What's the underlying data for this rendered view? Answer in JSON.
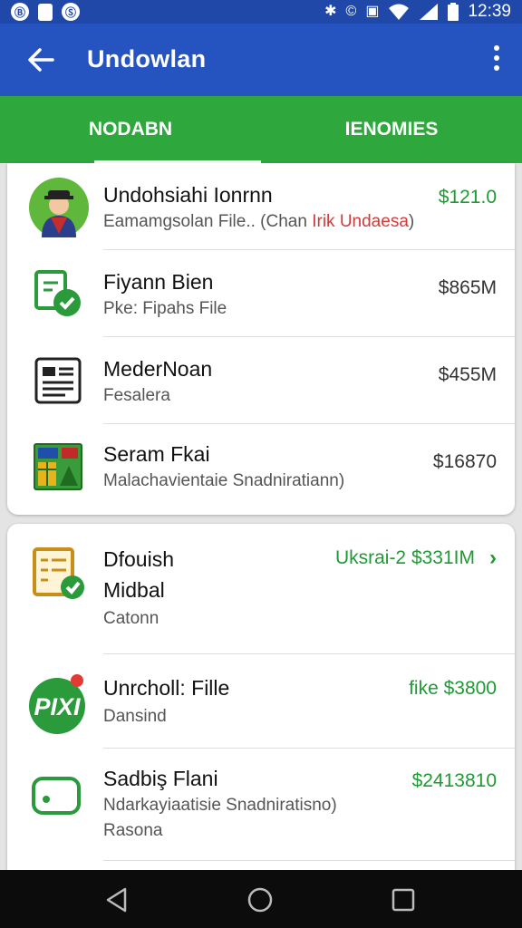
{
  "status_bar": {
    "left_icons": [
      "b-icon",
      "sim-card-icon",
      "s-icon"
    ],
    "left_glyphs": [
      "Ⓑ",
      "▯",
      "Ⓢ"
    ],
    "time": "12:39"
  },
  "app_bar": {
    "title": "Undowlan"
  },
  "tabs": [
    {
      "label": "NODABN",
      "selected": true
    },
    {
      "label": "IENOMIES",
      "selected": false
    }
  ],
  "colors": {
    "app_bar": "#2554c0",
    "tab_bar": "#2ea83d",
    "positive_amount": "#1f9a35"
  },
  "card1": {
    "rows": [
      {
        "icon": "avatar-icon",
        "title": "Undohsiahi Ionrnn",
        "subtitle_a": "Eamamgsolan File.. (Chan ",
        "subtitle_b": "Irik Undaesa",
        "subtitle_c": ")",
        "amount": "$121.0",
        "amount_green": true
      },
      {
        "icon": "file-check-icon",
        "title": "Fiyann Bien",
        "subtitle": "Pke: Fipahs File",
        "amount": "$865M",
        "amount_green": false
      },
      {
        "icon": "document-icon",
        "title": "MederNoan",
        "subtitle": "Fesalera",
        "amount": "$455M",
        "amount_green": false
      },
      {
        "icon": "spreadsheet-icon",
        "title": "Seram Fkai",
        "subtitle": "Malachavientaie Snadniratiann)",
        "amount": "$16870",
        "amount_green": false
      }
    ]
  },
  "card2": {
    "rows": [
      {
        "icon": "checklist-icon",
        "title": "Dfouish",
        "title2": "Midbal",
        "subtitle": "Catonn",
        "amount": "Uksrai-2 $331IM",
        "amount_green": true,
        "chevron": "›"
      },
      {
        "icon": "pix-icon",
        "title": "Unrcholl: Fille",
        "subtitle": "Dansind",
        "amount": "fike $3800",
        "amount_green": true
      },
      {
        "icon": "card-icon",
        "title": "Sadbiş Flani",
        "subtitle": "Ndarkayiaatisie Snadniratisno)",
        "tertiary": "Rasona",
        "amount": "$2413810",
        "amount_green": true
      }
    ]
  }
}
